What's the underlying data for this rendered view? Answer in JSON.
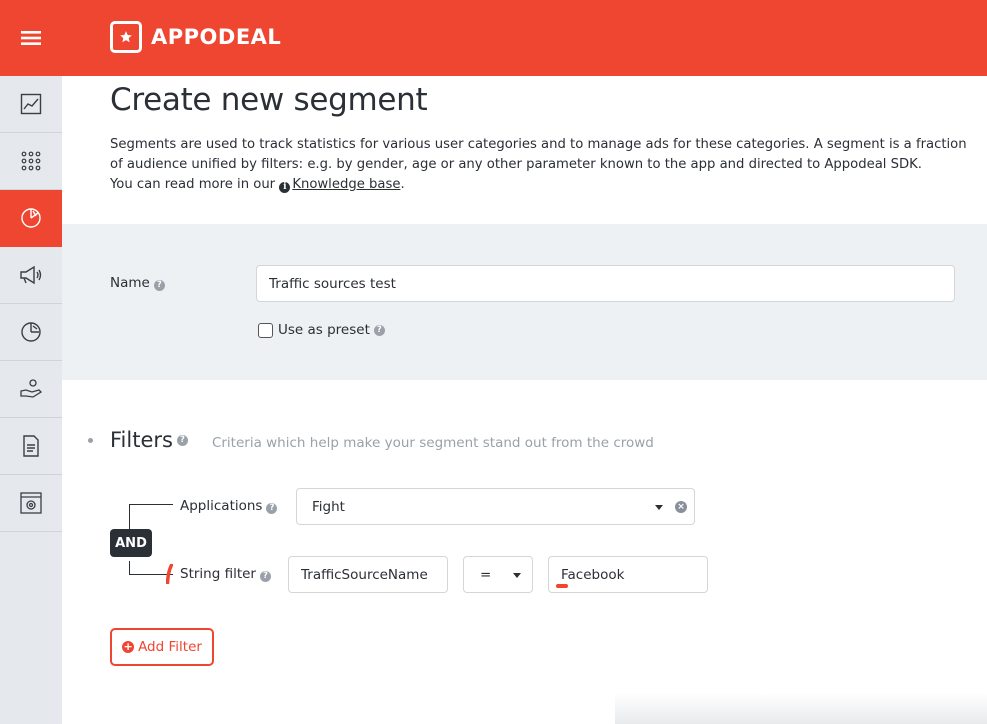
{
  "header": {
    "logo_text": "APPODEAL",
    "menu_icon": "hamburger-icon",
    "brand_color": "#ef4631"
  },
  "sidebar": {
    "items": [
      {
        "icon": "chart-line-icon",
        "active": false
      },
      {
        "icon": "apps-grid-icon",
        "active": false
      },
      {
        "icon": "segments-pie-icon",
        "active": true
      },
      {
        "icon": "megaphone-icon",
        "active": false
      },
      {
        "icon": "analytics-pie-icon",
        "active": false
      },
      {
        "icon": "payments-hand-icon",
        "active": false
      },
      {
        "icon": "document-icon",
        "active": false
      },
      {
        "icon": "settings-window-icon",
        "active": false
      }
    ]
  },
  "page": {
    "title": "Create new segment",
    "description_line1": "Segments are used to track statistics for various user categories and to manage ads for these categories. A segment is a fraction of audience unified by filters: e.g. by gender, age or any other parameter known to the app and directed to Appodeal SDK.",
    "description_prefix": "You can read more in our ",
    "knowledge_link": "Knowledge base",
    "description_suffix": "."
  },
  "name_section": {
    "label": "Name",
    "value": "Traffic sources test",
    "preset_label": "Use as preset",
    "preset_checked": false
  },
  "filters": {
    "title": "Filters",
    "subtitle": "Criteria which help make your segment stand out from the crowd",
    "operator": "AND",
    "applications_label": "Applications",
    "applications_value": "Fight",
    "string_filter_label": "String filter",
    "string_field": "TrafficSourceName",
    "string_operator": "=",
    "string_value": "Facebook",
    "add_filter_label": "Add Filter"
  }
}
